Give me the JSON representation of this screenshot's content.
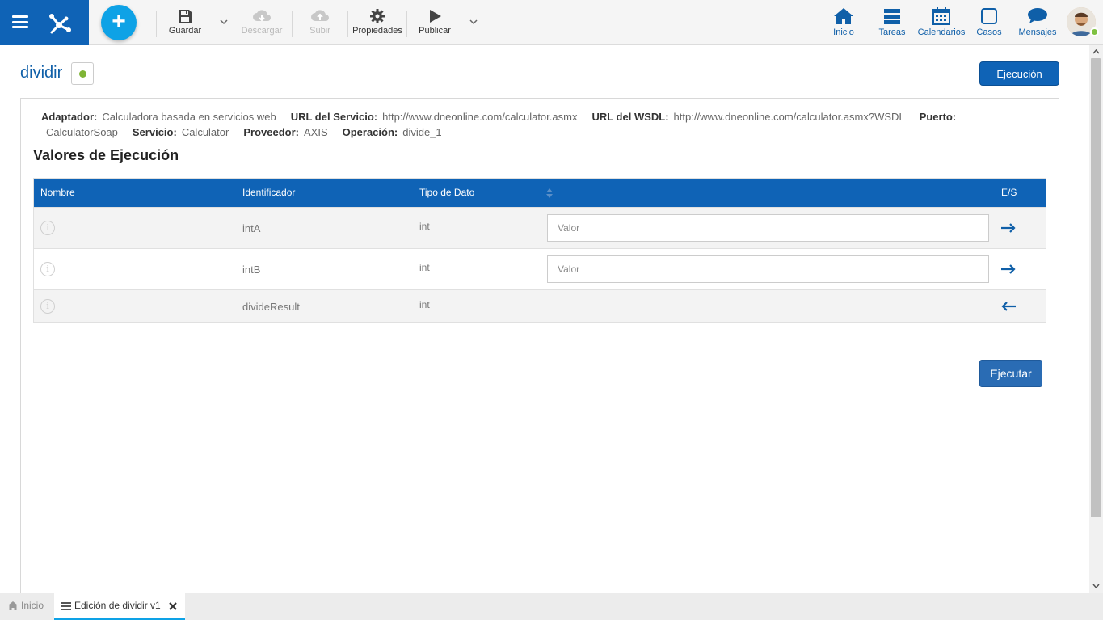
{
  "toolbar": {
    "save": "Guardar",
    "download": "Descargar",
    "upload": "Subir",
    "properties": "Propiedades",
    "publish": "Publicar"
  },
  "nav": {
    "home": "Inicio",
    "tasks": "Tareas",
    "calendars": "Calendarios",
    "cases": "Casos",
    "messages": "Mensajes"
  },
  "page": {
    "title": "dividir",
    "execution_tab": "Ejecución"
  },
  "info": [
    {
      "label": "Adaptador:",
      "value": "Calculadora basada en servicios web"
    },
    {
      "label": "URL del Servicio:",
      "value": "http://www.dneonline.com/calculator.asmx"
    },
    {
      "label": "URL del WSDL:",
      "value": "http://www.dneonline.com/calculator.asmx?WSDL"
    },
    {
      "label": "Puerto:",
      "value": "CalculatorSoap"
    },
    {
      "label": "Servicio:",
      "value": "Calculator"
    },
    {
      "label": "Proveedor:",
      "value": "AXIS"
    },
    {
      "label": "Operación:",
      "value": "divide_1"
    }
  ],
  "section_title": "Valores de Ejecución",
  "grid": {
    "headers": {
      "name": "Nombre",
      "identifier": "Identificador",
      "type": "Tipo de Dato",
      "io": "E/S"
    },
    "rows": [
      {
        "identifier": "intA",
        "type": "int",
        "placeholder": "Valor",
        "direction": "in"
      },
      {
        "identifier": "intB",
        "type": "int",
        "placeholder": "Valor",
        "direction": "in"
      },
      {
        "identifier": "divideResult",
        "type": "int",
        "direction": "out"
      }
    ]
  },
  "run_button": "Ejecutar",
  "bottom_tabs": {
    "home": "Inicio",
    "edit": "Edición de dividir v1"
  },
  "colors": {
    "primary": "#0f63b6",
    "accent": "#0ea2e6",
    "status": "#7fb435"
  }
}
